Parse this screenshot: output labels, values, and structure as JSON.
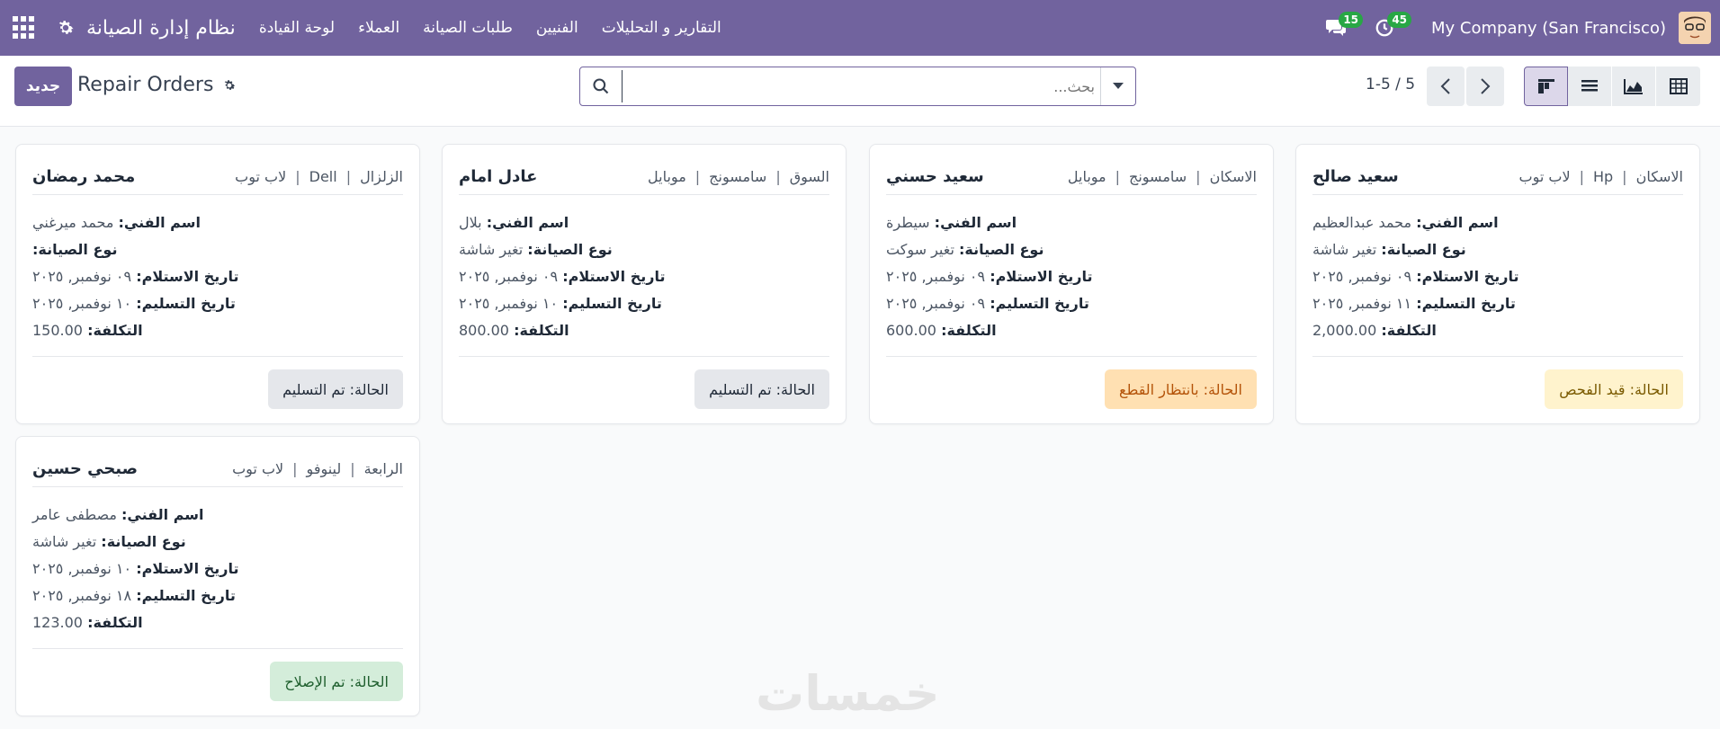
{
  "navbar": {
    "app_name": "نظام إدارة الصيانة",
    "menu": [
      "لوحة القيادة",
      "العملاء",
      "طلبات الصيانة",
      "الفنيين",
      "التقارير و التحليلات"
    ],
    "messages_count": "15",
    "activities_count": "45",
    "company": "My Company (San Francisco)"
  },
  "control": {
    "new_label": "جديد",
    "breadcrumb": "Repair Orders",
    "search_placeholder": "بحث...",
    "pager": "1-5 / 5"
  },
  "labels": {
    "technician": "اسم الفني:",
    "repair_type": "نوع الصيانة",
    "received": "تاريخ الاستلام:",
    "delivered": "تاريخ التسليم:",
    "cost": "التكلفة:",
    "status": "الحالة:"
  },
  "cards": [
    {
      "customer": "سعيد صالح",
      "tags": [
        "الاسكان",
        "Hp",
        "لاب توب"
      ],
      "technician": "محمد عبدالعظيم",
      "repair_type": "تغير شاشة",
      "received": "٠٩ نوفمبر, ٢٠٢٥",
      "delivered": "١١ نوفمبر, ٢٠٢٥",
      "cost": "2,000.00",
      "status": "قيد الفحص",
      "status_color": "#fff3cd"
    },
    {
      "customer": "سعيد حسني",
      "tags": [
        "الاسكان",
        "سامسونج",
        "موبايل"
      ],
      "technician": "سيطرة",
      "repair_type": "تغير سوكت",
      "received": "٠٩ نوفمبر, ٢٠٢٥",
      "delivered": "٠٩ نوفمبر, ٢٠٢٥",
      "cost": "600.00",
      "status": "بانتظار القطع",
      "status_color": "#ffe0b2"
    },
    {
      "customer": "عادل امام",
      "tags": [
        "السوق",
        "سامسونج",
        "موبايل"
      ],
      "technician": "بلال",
      "repair_type": "تغير شاشة",
      "received": "٠٩ نوفمبر, ٢٠٢٥",
      "delivered": "١٠ نوفمبر, ٢٠٢٥",
      "cost": "800.00",
      "status": "تم التسليم",
      "status_color": "#e5e7eb"
    },
    {
      "customer": "محمد رمضان",
      "tags": [
        "الزلزال",
        "Dell",
        "لاب توب"
      ],
      "technician": "محمد ميرغني",
      "repair_type": "",
      "received": "٠٩ نوفمبر, ٢٠٢٥",
      "delivered": "١٠ نوفمبر, ٢٠٢٥",
      "cost": "150.00",
      "status": "تم التسليم",
      "status_color": "#e5e7eb"
    },
    {
      "customer": "صبحي حسين",
      "tags": [
        "الرابعة",
        "لينوفو",
        "لاب توب"
      ],
      "technician": "مصطفى عامر",
      "repair_type": "تغير شاشة",
      "received": "١٠ نوفمبر, ٢٠٢٥",
      "delivered": "١٨ نوفمبر, ٢٠٢٥",
      "cost": "123.00",
      "status": "تم الإصلاح",
      "status_color": "#d4edda"
    }
  ],
  "watermark": "خمسات"
}
